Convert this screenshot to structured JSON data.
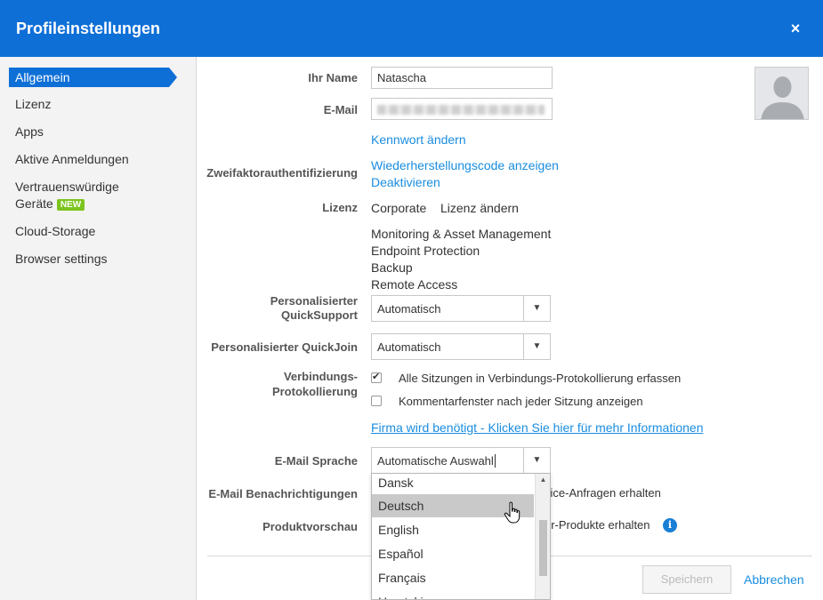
{
  "dialog": {
    "title": "Profileinstellungen",
    "close_icon": "×"
  },
  "sidebar": {
    "active": "Allgemein",
    "items": [
      "Lizenz",
      "Apps",
      "Aktive Anmeldungen",
      "Vertrauenswürdige",
      "Geräte",
      "Cloud-Storage",
      "Browser settings"
    ],
    "badge": "NEW"
  },
  "form": {
    "name_label": "Ihr Name",
    "name_value": "Natascha",
    "email_label": "E-Mail",
    "change_password": "Kennwort ändern",
    "twofa_label": "Zweifaktorauthentifizierung",
    "twofa_show_code": "Wiederherstellungscode anzeigen",
    "twofa_deactivate": "Deaktivieren",
    "license_label": "Lizenz",
    "license_value": "Corporate",
    "license_change": "Lizenz ändern",
    "addons": [
      "Monitoring & Asset Management",
      "Endpoint Protection",
      "Backup",
      "Remote Access"
    ],
    "qs_label_1": "Personalisierter",
    "qs_label_2": "QuickSupport",
    "qs_value": "Automatisch",
    "qj_label": "Personalisierter QuickJoin",
    "qj_value": "Automatisch",
    "conn_label_1": "Verbindungs-",
    "conn_label_2": "Protokollierung",
    "conn_opt1": "Alle Sitzungen in Verbindungs-Protokollierung erfassen",
    "conn_opt2": "Kommentarfenster nach jeder Sitzung anzeigen",
    "company_link": "Firma wird benötigt - Klicken Sie hier für mehr Informationen",
    "lang_label": "E-Mail Sprache",
    "lang_value": "Automatische Auswahl",
    "notif_label": "E-Mail Benachrichtigungen",
    "notif_text": "vice-Anfragen erhalten",
    "preview_label": "Produktvorschau",
    "preview_text": "er-Produkte erhalten",
    "info_icon": "i"
  },
  "lang_options": [
    "Dansk",
    "Deutsch",
    "English",
    "Español",
    "Français",
    "Hrvatski"
  ],
  "footer": {
    "save": "Speichern",
    "cancel": "Abbrechen"
  },
  "colors": {
    "accent": "#0e6fd7",
    "link": "#1a8de0",
    "badge": "#7cc41f"
  }
}
